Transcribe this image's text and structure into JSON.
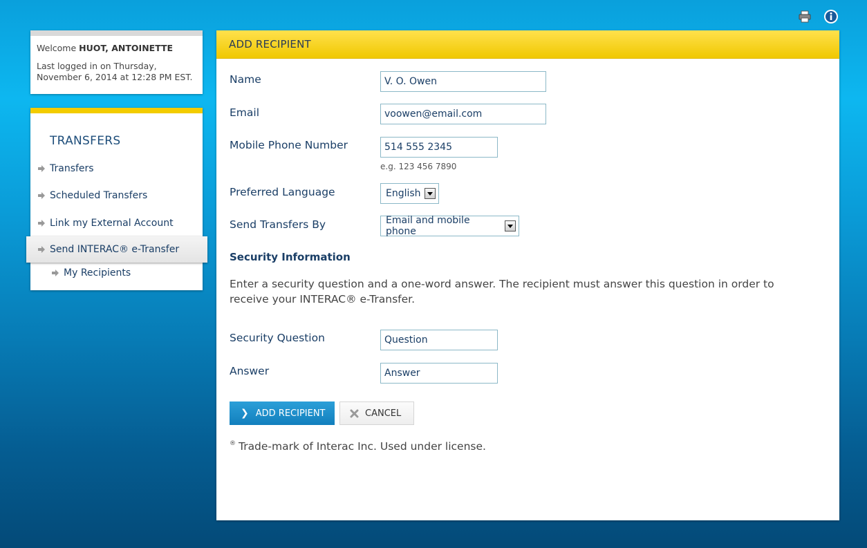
{
  "header_icons": {
    "print": "print-icon",
    "info": "info-icon"
  },
  "welcome": {
    "prefix": "Welcome",
    "name": "HUOT, ANTOINETTE",
    "last_logged": "Last logged in on Thursday, November 6, 2014 at 12:28 PM EST."
  },
  "nav": {
    "heading": "TRANSFERS",
    "items": [
      {
        "label": "Transfers"
      },
      {
        "label": "Scheduled Transfers"
      },
      {
        "label": "Link my External Account"
      },
      {
        "label": "Send INTERAC® e-Transfer"
      }
    ],
    "sub_item": {
      "label": "My Recipients"
    }
  },
  "form": {
    "title": "ADD RECIPIENT",
    "name_label": "Name",
    "name_value": "V. O. Owen",
    "email_label": "Email",
    "email_value": "voowen@email.com",
    "phone_label": "Mobile Phone Number",
    "phone_value": "514 555 2345",
    "phone_hint": "e.g. 123 456 7890",
    "language_label": "Preferred Language",
    "language_value": "English",
    "send_by_label": "Send Transfers By",
    "send_by_value": "Email and mobile phone",
    "security_heading": "Security Information",
    "security_desc": "Enter a security question and a one-word answer. The recipient must answer this question in order to receive your INTERAC® e-Transfer.",
    "question_label": "Security Question",
    "question_value": "Question",
    "answer_label": "Answer",
    "answer_value": "Answer",
    "add_button": "ADD RECIPIENT",
    "cancel_button": "CANCEL",
    "footnote_mark": "®",
    "footnote": "Trade-mark of Interac Inc. Used under license."
  }
}
